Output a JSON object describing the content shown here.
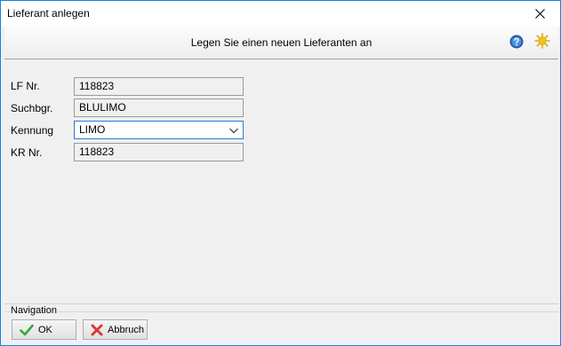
{
  "window": {
    "title": "Lieferant anlegen"
  },
  "header": {
    "text": "Legen Sie einen neuen Lieferanten an"
  },
  "form": {
    "fields": [
      {
        "label": "LF Nr.",
        "value": "118823"
      },
      {
        "label": "Suchbgr.",
        "value": "BLULIMO"
      },
      {
        "label": "Kennung",
        "value": "LIMO"
      },
      {
        "label": "KR Nr.",
        "value": "118823"
      }
    ]
  },
  "navigation": {
    "legend": "Navigation",
    "ok_label": "OK",
    "cancel_label": "Abbruch"
  },
  "colors": {
    "window_border": "#1883d7",
    "select_border": "#2b7ad6",
    "ok_check": "#3aa63a",
    "cancel_x": "#d83a3a",
    "help_blue": "#2f6fc9",
    "sun_yellow": "#f2c417"
  }
}
